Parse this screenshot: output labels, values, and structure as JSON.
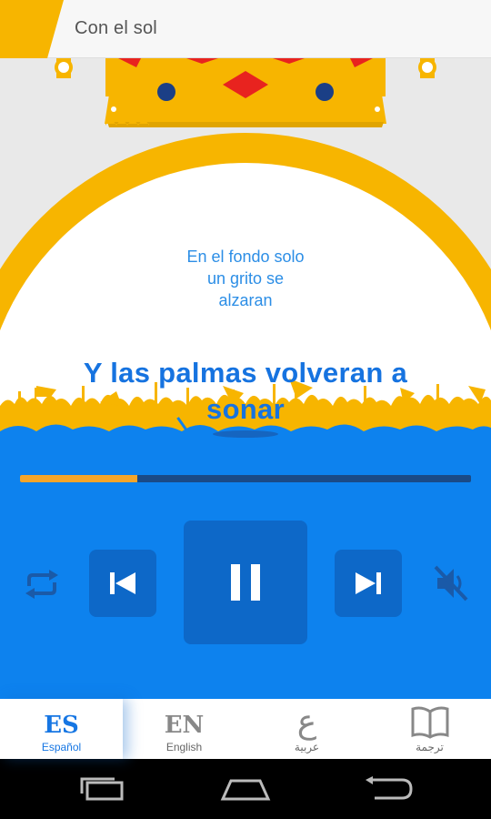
{
  "header": {
    "title": "Con el sol"
  },
  "lyrics": {
    "previous_lines": [
      "En el fondo solo",
      "un grito se",
      "alzaran"
    ],
    "current_lines": [
      "Y las palmas volveran a",
      "sonar"
    ]
  },
  "player": {
    "progress": 0.26,
    "state": "playing",
    "controls": {
      "repeat": "repeat-icon",
      "previous": "skip-previous-icon",
      "play_pause": "pause-icon",
      "next": "skip-next-icon",
      "mute": "volume-off-icon"
    }
  },
  "tabs": [
    {
      "code": "ES",
      "label": "Español",
      "active": true
    },
    {
      "code": "EN",
      "label": "English",
      "active": false
    },
    {
      "glyph": "ع",
      "label": "عربية",
      "active": false
    },
    {
      "icon": "book-icon",
      "label": "ترجمة",
      "active": false
    }
  ],
  "colors": {
    "accent_blue": "#0d82ee",
    "button_blue": "#0d68c8",
    "gold": "#f7b500",
    "progress_orange": "#f4a52a",
    "crown_red": "#e8231f",
    "crown_navy": "#1b3f86"
  },
  "navbar": {
    "buttons": [
      "recent-apps-icon",
      "home-icon",
      "back-icon"
    ]
  }
}
